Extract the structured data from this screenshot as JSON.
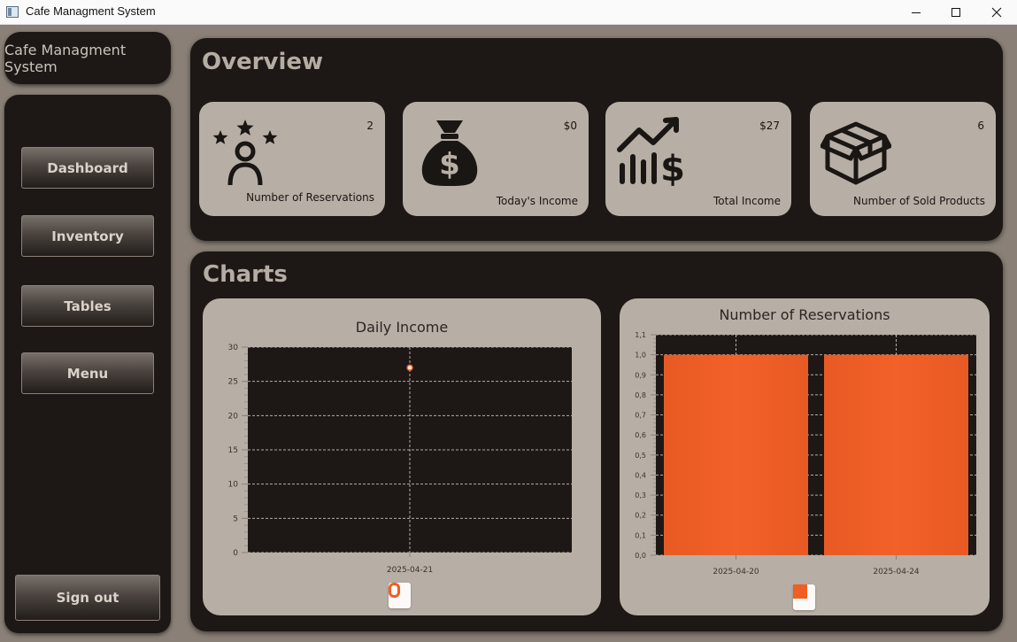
{
  "window": {
    "title": "Cafe Managment System"
  },
  "sidebar": {
    "brand": "Cafe Managment System",
    "items": [
      {
        "label": "Dashboard"
      },
      {
        "label": "Inventory"
      },
      {
        "label": "Tables"
      },
      {
        "label": "Menu"
      }
    ],
    "signout_label": "Sign out"
  },
  "overview": {
    "title": "Overview",
    "cards": [
      {
        "value": "2",
        "label": "Number of Reservations",
        "icon": "reservation-stars-icon"
      },
      {
        "value": "$0",
        "label": "Today's Income",
        "icon": "money-bag-icon"
      },
      {
        "value": "$27",
        "label": "Total Income",
        "icon": "income-trend-icon"
      },
      {
        "value": "6",
        "label": "Number of Sold Products",
        "icon": "box-icon"
      }
    ]
  },
  "charts_section": {
    "title": "Charts"
  },
  "chart_data": [
    {
      "type": "line",
      "title": "Daily Income",
      "xlabel": "",
      "ylabel": "",
      "x": [
        "2025-04-21"
      ],
      "series": [
        {
          "values": [
            27
          ]
        }
      ],
      "ylim": [
        0,
        30
      ],
      "yticks": [
        "0",
        "5",
        "10",
        "15",
        "20",
        "25",
        "30"
      ],
      "grid": true,
      "legend": "bottom",
      "colors": {
        "plot_bg": "#1d1816",
        "point": "#f05e23"
      }
    },
    {
      "type": "bar",
      "title": "Number of Reservations",
      "xlabel": "",
      "ylabel": "",
      "categories": [
        "2025-04-20",
        "2025-04-24"
      ],
      "series": [
        {
          "values": [
            1,
            1
          ]
        }
      ],
      "ylim": [
        0,
        1.1
      ],
      "yticks": [
        "0,0",
        "0,1",
        "0,2",
        "0,3",
        "0,4",
        "0,5",
        "0,6",
        "0,7",
        "0,8",
        "0,9",
        "1,0",
        "1,1"
      ],
      "grid": true,
      "legend": "bottom",
      "colors": {
        "plot_bg": "#1d1816",
        "bar": "#f05e23"
      }
    }
  ],
  "colors": {
    "panel": "#1d1816",
    "card": "#b7aea5",
    "accent": "#f05e23",
    "background": "#8a8077"
  }
}
